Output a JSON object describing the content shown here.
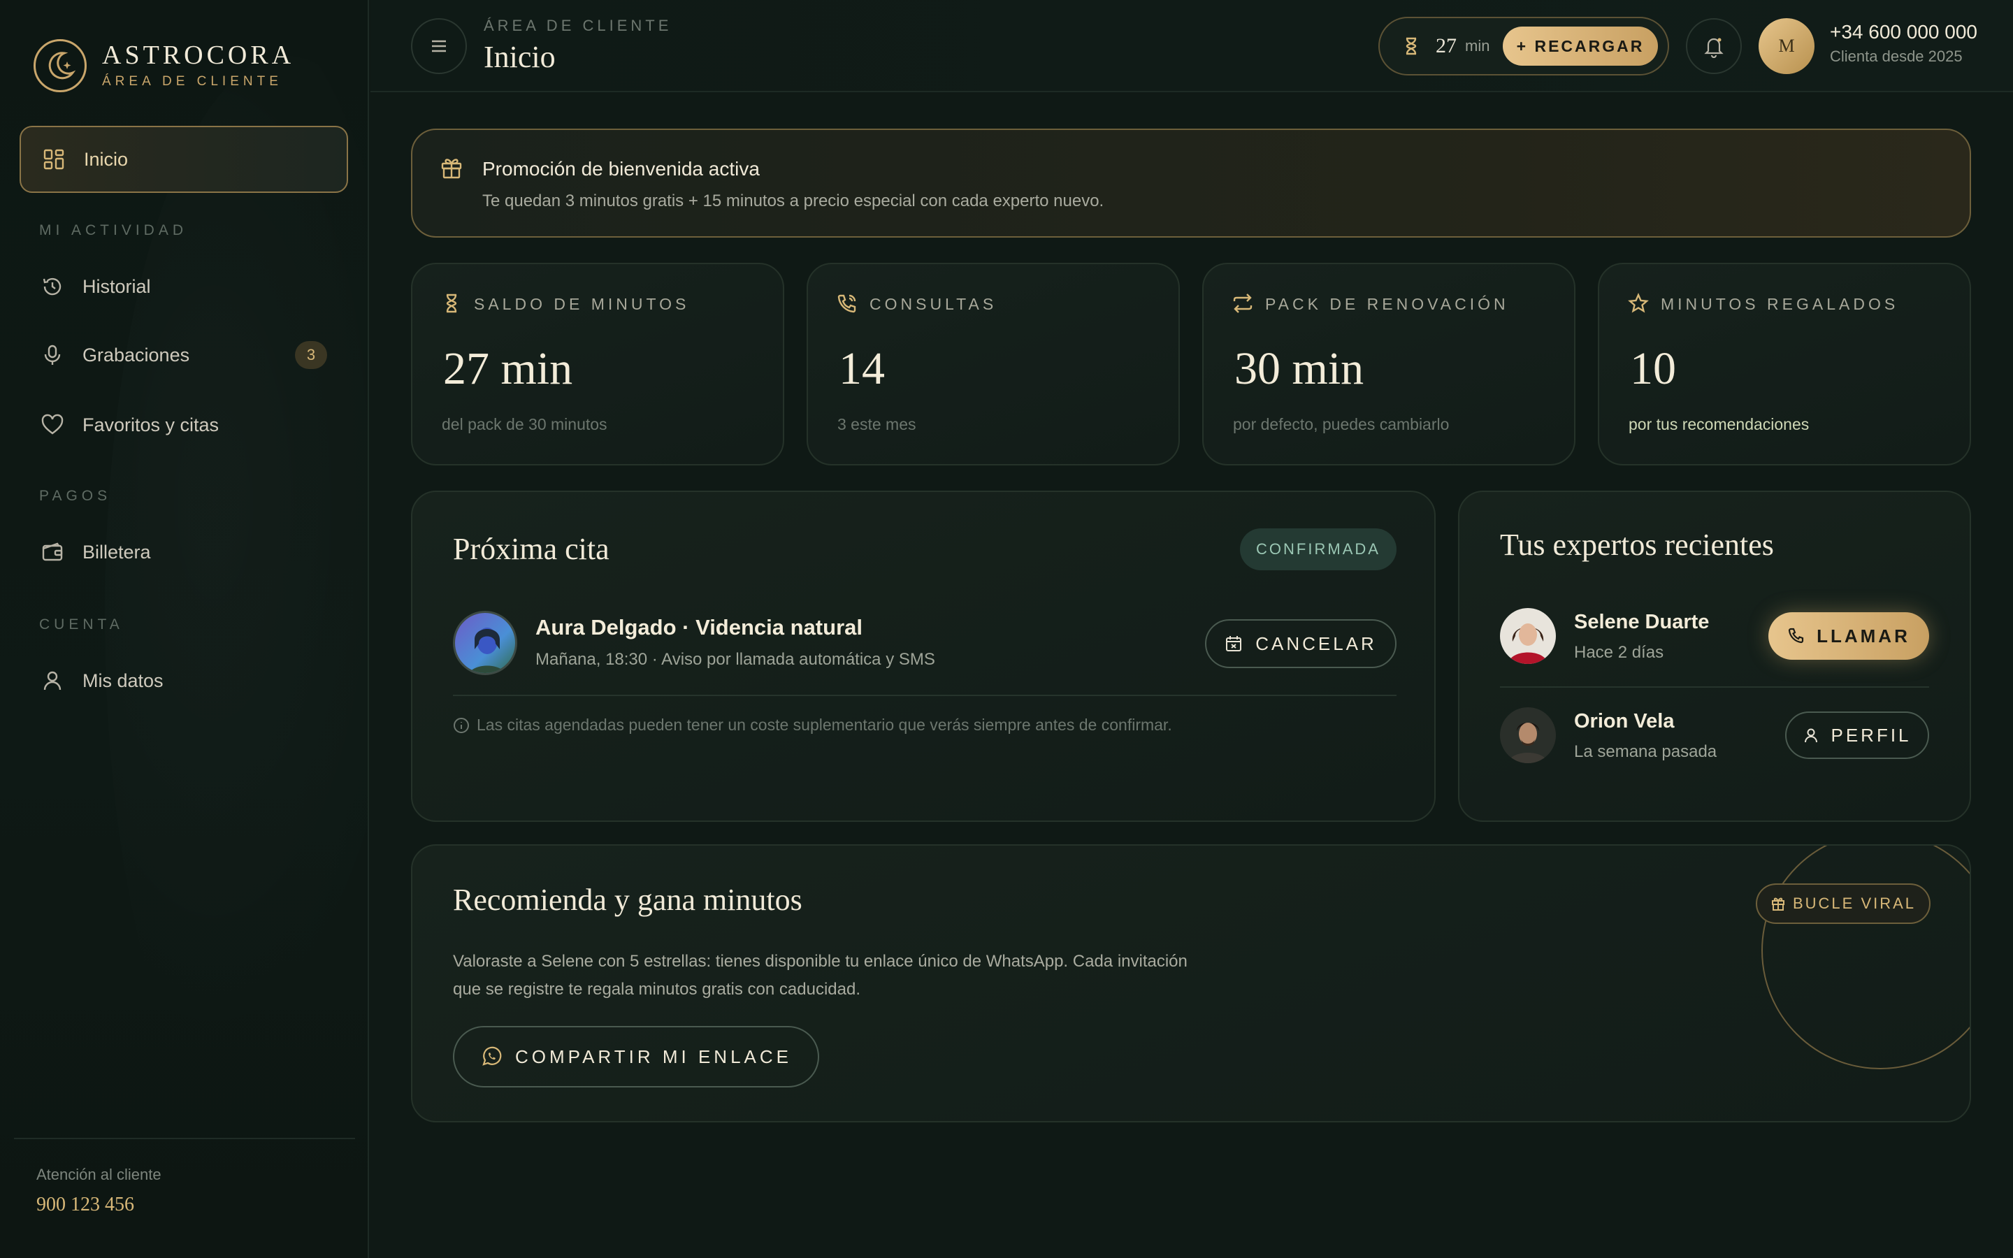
{
  "brand": {
    "name": "ASTROCORA",
    "subtitle": "ÁREA DE CLIENTE"
  },
  "sidebar": {
    "active": {
      "label": "Inicio",
      "icon": "grid-icon"
    },
    "sections": [
      {
        "title": "MI ACTIVIDAD",
        "items": [
          {
            "label": "Historial",
            "icon": "history-icon"
          },
          {
            "label": "Grabaciones",
            "icon": "microphone-icon",
            "badge": "3"
          },
          {
            "label": "Favoritos y citas",
            "icon": "heart-icon"
          }
        ]
      },
      {
        "title": "PAGOS",
        "items": [
          {
            "label": "Billetera",
            "icon": "wallet-icon"
          }
        ]
      },
      {
        "title": "CUENTA",
        "items": [
          {
            "label": "Mis datos",
            "icon": "user-icon"
          }
        ]
      }
    ],
    "footer": {
      "label": "Atención al cliente",
      "phone": "900 123 456"
    }
  },
  "header": {
    "kicker": "ÁREA DE CLIENTE",
    "title": "Inicio",
    "balance": {
      "value": "27",
      "unit": "min",
      "recharge_label": "+ RECARGAR"
    },
    "user": {
      "initial": "M",
      "phone": "+34 600 000 000",
      "since": "Clienta desde 2025"
    }
  },
  "promo": {
    "title": "Promoción de bienvenida activa",
    "text": "Te quedan 3 minutos gratis + 15 minutos a precio especial con cada experto nuevo."
  },
  "stats": [
    {
      "label": "SALDO DE MINUTOS",
      "value": "27 min",
      "sub": "del pack de 30 minutos",
      "icon": "hourglass-icon"
    },
    {
      "label": "CONSULTAS",
      "value": "14",
      "sub": "3 este mes",
      "icon": "phone-call-icon"
    },
    {
      "label": "PACK DE RENOVACIÓN",
      "value": "30 min",
      "sub": "por defecto, puedes cambiarlo",
      "icon": "renew-icon"
    },
    {
      "label": "MINUTOS REGALADOS",
      "value": "10",
      "sub": "por tus recomendaciones",
      "icon": "star-icon"
    }
  ],
  "appointment": {
    "title": "Próxima cita",
    "status": "CONFIRMADA",
    "expert": "Aura Delgado · Videncia natural",
    "when": "Mañana, 18:30 · Aviso por llamada automática y SMS",
    "cancel_label": "CANCELAR",
    "note": "Las citas agendadas pueden tener un coste suplementario que verás siempre antes de confirmar."
  },
  "experts": {
    "title": "Tus expertos recientes",
    "items": [
      {
        "name": "Selene Duarte",
        "when": "Hace 2 días",
        "action": "LLAMAR"
      },
      {
        "name": "Orion Vela",
        "when": "La semana pasada",
        "action": "PERFIL"
      }
    ]
  },
  "referral": {
    "title": "Recomienda y gana minutos",
    "badge": "BUCLE VIRAL",
    "text": "Valoraste a Selene con 5 estrellas: tienes disponible tu enlace único de WhatsApp. Cada invitación que se registre te regala minutos gratis con caducidad.",
    "share_label": "COMPARTIR MI ENLACE"
  },
  "colors": {
    "accent_gold": "#c9a66b",
    "background": "#0f1915",
    "success": "#9bc7b4"
  }
}
